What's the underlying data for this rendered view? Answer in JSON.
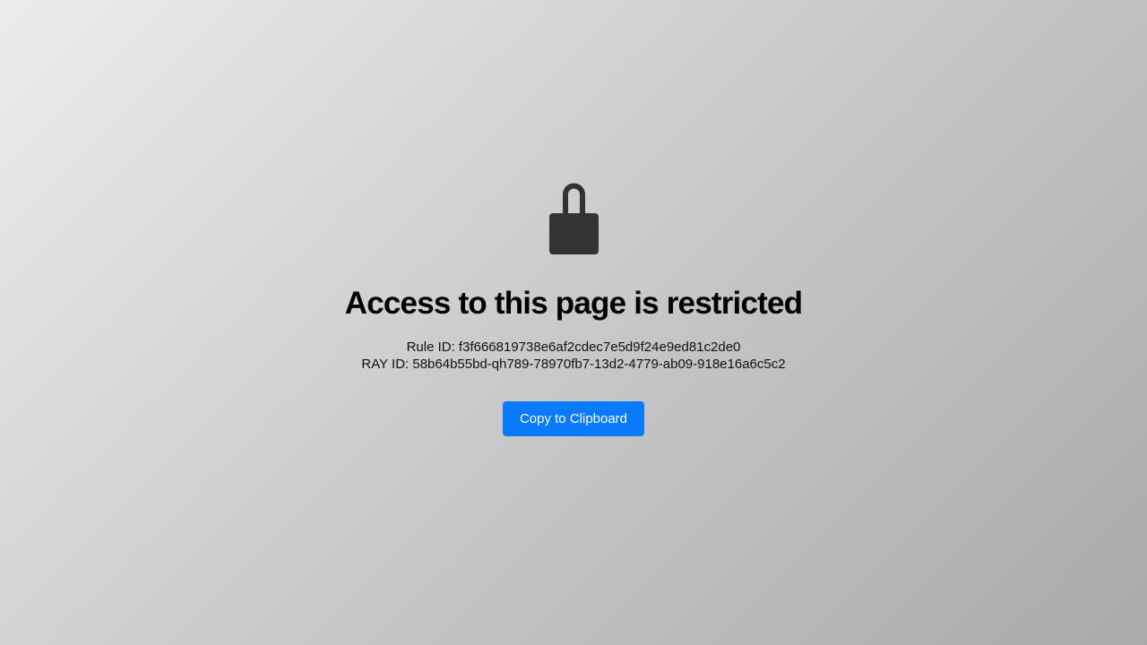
{
  "icon": {
    "name": "lock-icon",
    "color": "#333333"
  },
  "heading": "Access to this page is restricted",
  "rule_id_line": "Rule ID: f3f666819738e6af2cdec7e5d9f24e9ed81c2de0",
  "ray_id_line": "RAY ID: 58b64b55bd-qh789-78970fb7-13d2-4779-ab09-918e16a6c5c2",
  "copy_button": {
    "label": "Copy to Clipboard",
    "color": "#0a7bff"
  }
}
